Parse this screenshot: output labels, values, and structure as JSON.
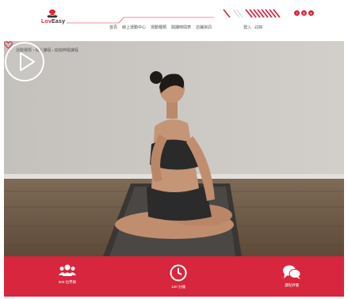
{
  "brand": {
    "logo_text_1": "Lov",
    "logo_text_2": "Easy",
    "accent_color": "#d7263d"
  },
  "nav": {
    "items": [
      "首頁",
      "線上運動中心",
      "運動種類",
      "開課時間表",
      "店鋪資訊"
    ]
  },
  "auth": {
    "login": "登入",
    "register": "註冊"
  },
  "social": {
    "icons": [
      "facebook-icon",
      "instagram-icon",
      "line-icon"
    ]
  },
  "hero": {
    "breadcrumb": "運動種類 › 線上課程 › 瑜伽伸展課程",
    "play_icon": "play-icon",
    "favorite_icon": "heart-icon"
  },
  "features": [
    {
      "icon": "users-icon",
      "label": "500 位學員"
    },
    {
      "icon": "clock-icon",
      "label": "120 分鐘"
    },
    {
      "icon": "chat-icon",
      "label": "課程評價"
    }
  ]
}
